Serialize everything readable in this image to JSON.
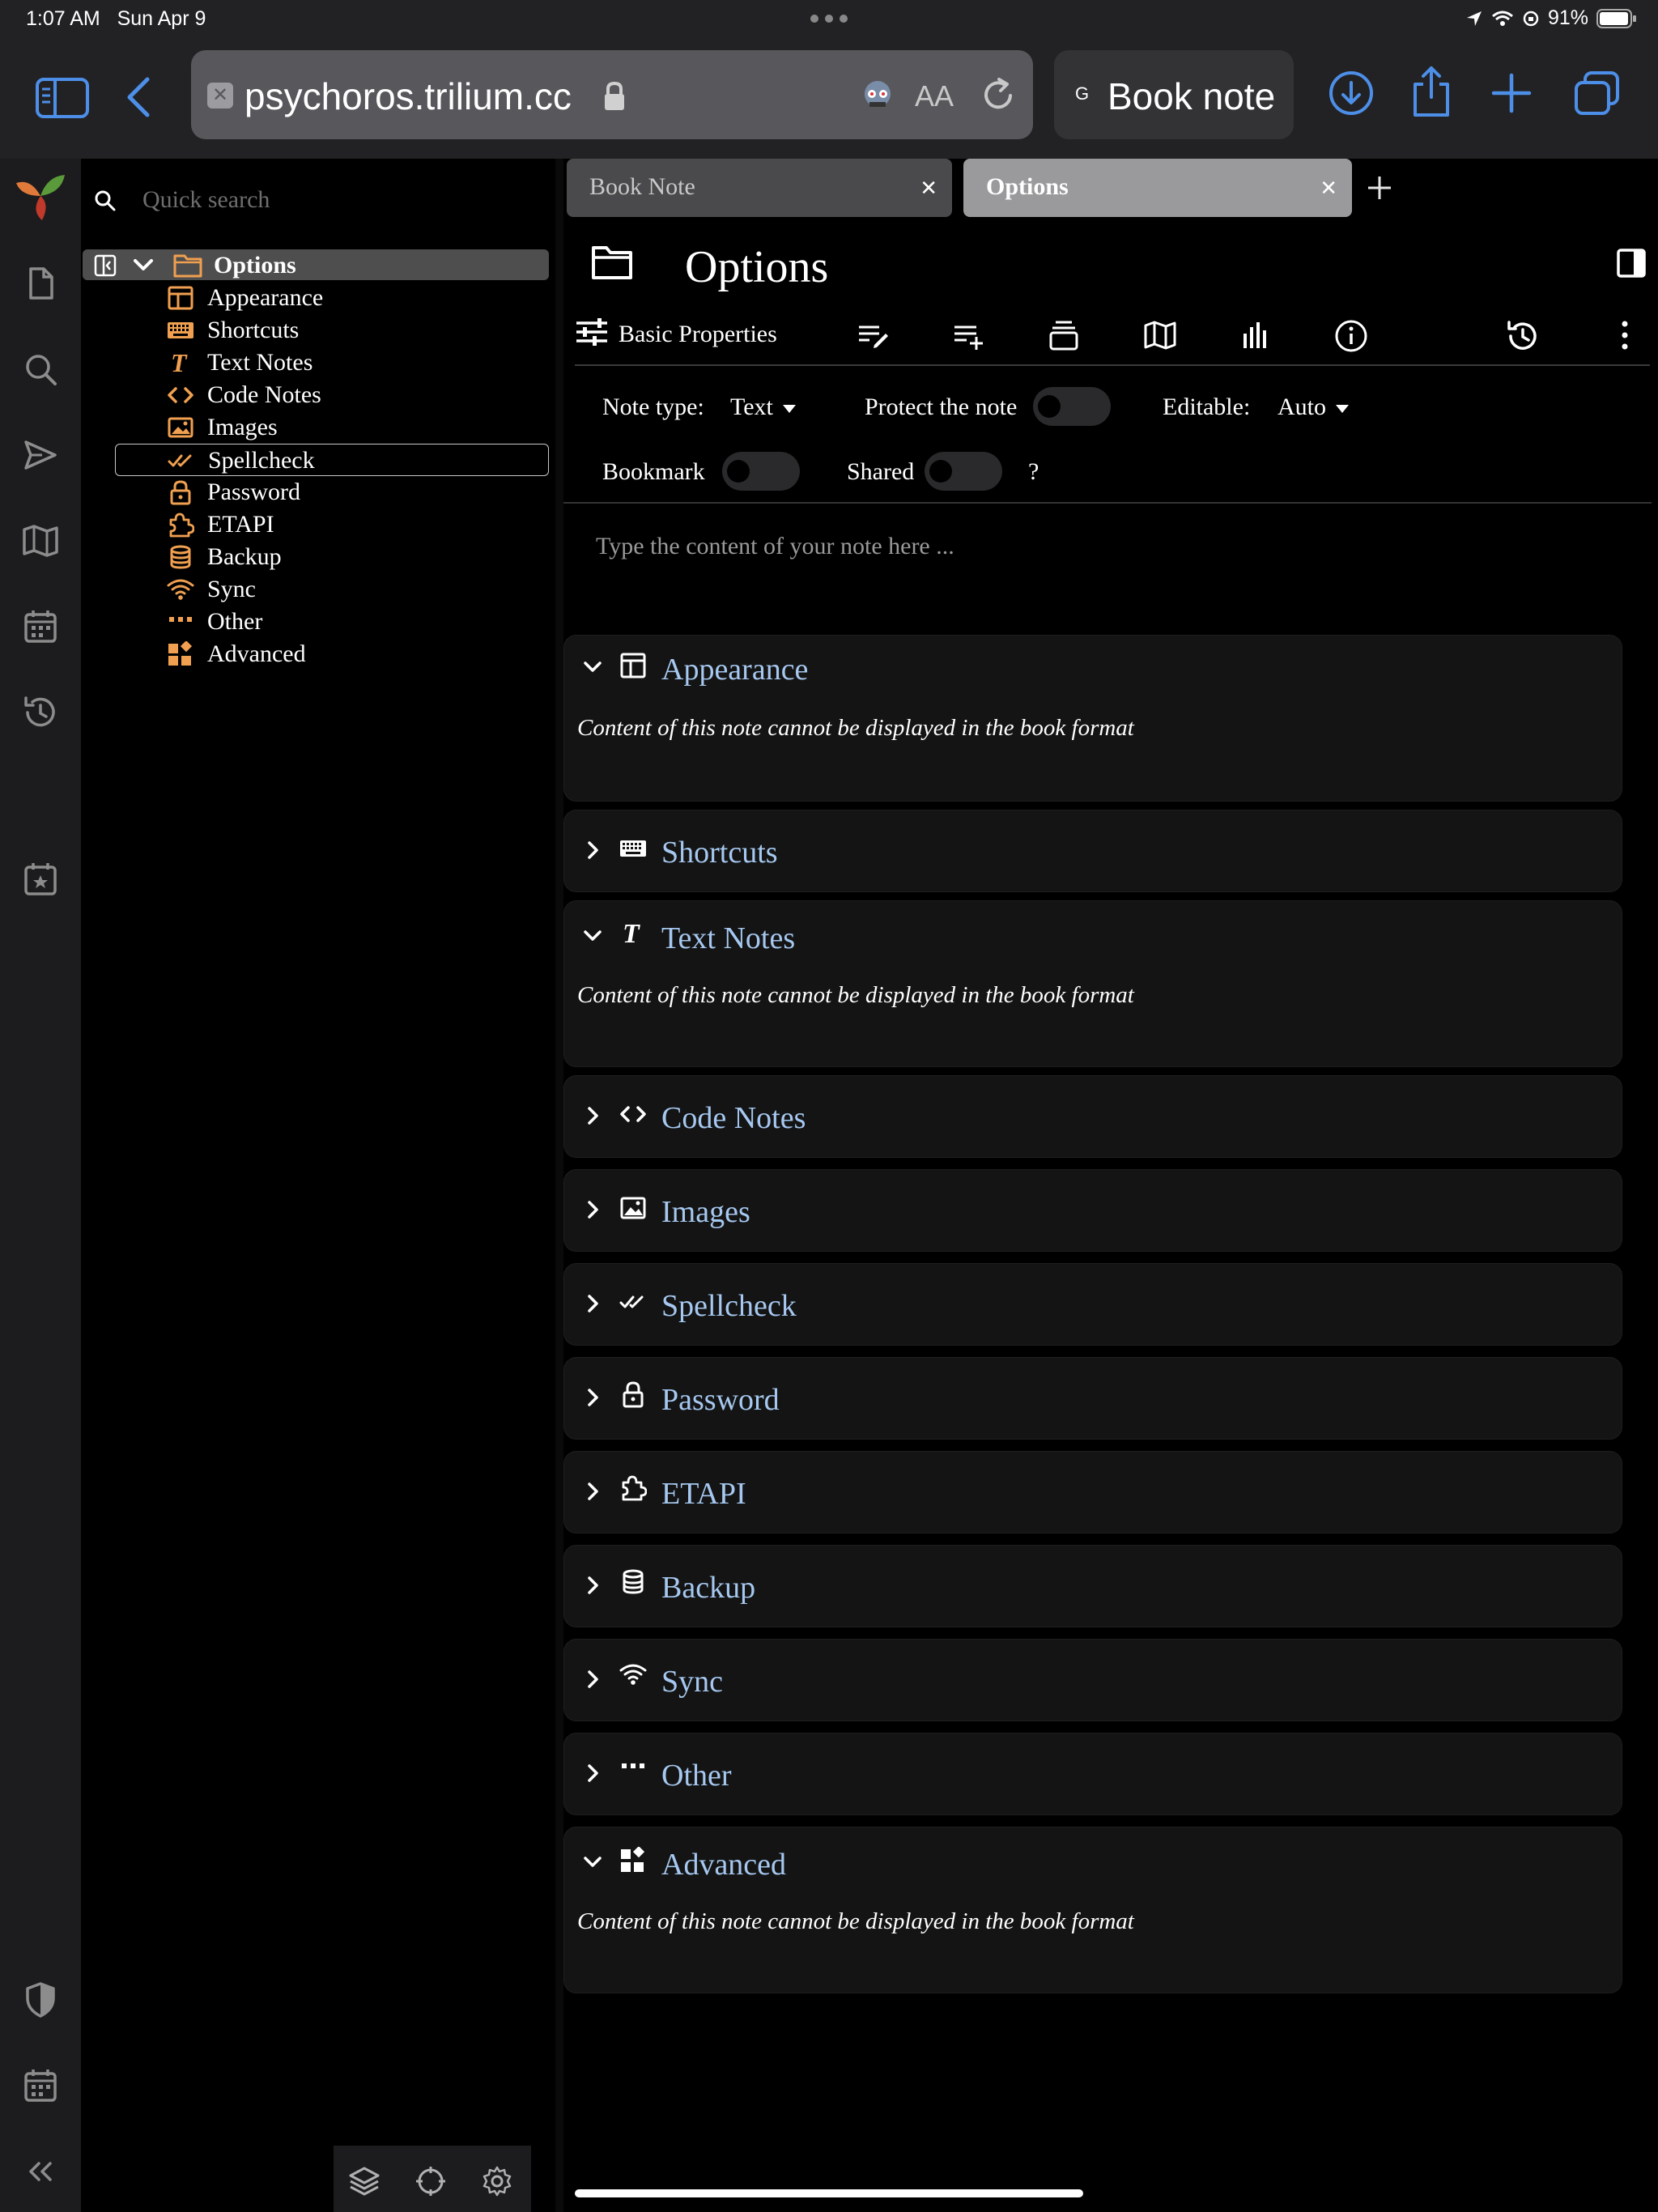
{
  "status_bar": {
    "time": "1:07 AM",
    "date": "Sun Apr 9",
    "battery": "91%"
  },
  "safari": {
    "url": "psychoros.trilium.cc",
    "favicon_glyph": "✕",
    "second_tab_favicon": "G",
    "second_tab_title": "Book note",
    "accent_color": "#4d8fe8"
  },
  "sidebar": {
    "search_placeholder": "Quick search",
    "root": {
      "label": "Options",
      "icon": "folder-icon"
    },
    "items": [
      {
        "label": "Appearance",
        "icon": "layout-icon"
      },
      {
        "label": "Shortcuts",
        "icon": "keyboard-icon"
      },
      {
        "label": "Text Notes",
        "icon": "text-icon"
      },
      {
        "label": "Code Notes",
        "icon": "code-icon"
      },
      {
        "label": "Images",
        "icon": "image-icon"
      },
      {
        "label": "Spellcheck",
        "icon": "check-double-icon"
      },
      {
        "label": "Password",
        "icon": "lock-icon"
      },
      {
        "label": "ETAPI",
        "icon": "extension-icon"
      },
      {
        "label": "Backup",
        "icon": "database-icon"
      },
      {
        "label": "Sync",
        "icon": "wifi-icon"
      },
      {
        "label": "Other",
        "icon": "dots-icon"
      },
      {
        "label": "Advanced",
        "icon": "widget-icon"
      }
    ],
    "icon_color": "#f0a050"
  },
  "tabs": [
    {
      "title": "Book Note"
    },
    {
      "title": "Options"
    }
  ],
  "note": {
    "title": "Options",
    "ribbon_basic_label": "Basic Properties",
    "note_type_label": "Note type:",
    "note_type_value": "Text",
    "protect_label": "Protect the note",
    "editable_label": "Editable:",
    "editable_value": "Auto",
    "bookmark_label": "Bookmark",
    "shared_label": "Shared",
    "help_label": "?",
    "editor_placeholder": "Type the content of your note here ..."
  },
  "children": [
    {
      "title": "Appearance",
      "expanded": true,
      "icon": "layout-icon",
      "body": "Content of this note cannot be displayed in the book format"
    },
    {
      "title": "Shortcuts",
      "expanded": false,
      "icon": "keyboard-icon"
    },
    {
      "title": "Text Notes",
      "expanded": true,
      "icon": "text-icon",
      "body": "Content of this note cannot be displayed in the book format"
    },
    {
      "title": "Code Notes",
      "expanded": false,
      "icon": "code-icon"
    },
    {
      "title": "Images",
      "expanded": false,
      "icon": "image-icon"
    },
    {
      "title": "Spellcheck",
      "expanded": false,
      "icon": "check-double-icon"
    },
    {
      "title": "Password",
      "expanded": false,
      "icon": "lock-icon"
    },
    {
      "title": "ETAPI",
      "expanded": false,
      "icon": "extension-icon"
    },
    {
      "title": "Backup",
      "expanded": false,
      "icon": "database-icon"
    },
    {
      "title": "Sync",
      "expanded": false,
      "icon": "wifi-icon"
    },
    {
      "title": "Other",
      "expanded": false,
      "icon": "dots-icon"
    },
    {
      "title": "Advanced",
      "expanded": true,
      "icon": "widget-icon",
      "body": "Content of this note cannot be displayed in the book format"
    }
  ],
  "child_title_color": "#a6c8f0"
}
